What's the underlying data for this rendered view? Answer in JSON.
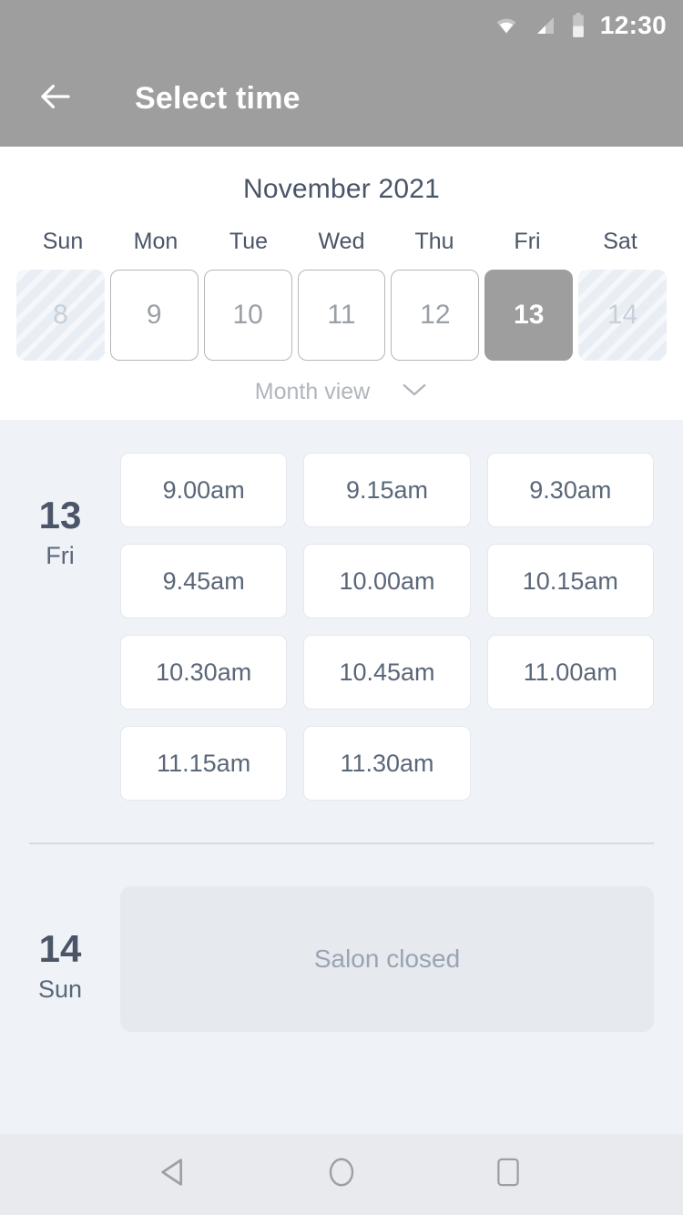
{
  "status_bar": {
    "time": "12:30",
    "icons": [
      "wifi-icon",
      "cellular-signal-icon",
      "battery-icon"
    ]
  },
  "app_bar": {
    "back_icon": "arrow-left-icon",
    "title": "Select time"
  },
  "calendar": {
    "title": "November 2021",
    "weekdays": [
      "Sun",
      "Mon",
      "Tue",
      "Wed",
      "Thu",
      "Fri",
      "Sat"
    ],
    "days": [
      {
        "label": "8",
        "state": "disabled"
      },
      {
        "label": "9",
        "state": "available"
      },
      {
        "label": "10",
        "state": "available"
      },
      {
        "label": "11",
        "state": "available"
      },
      {
        "label": "12",
        "state": "available"
      },
      {
        "label": "13",
        "state": "selected"
      },
      {
        "label": "14",
        "state": "disabled"
      }
    ],
    "month_view": {
      "label": "Month view",
      "chevron_icon": "chevron-down-icon"
    }
  },
  "schedule": {
    "groups": [
      {
        "day_number": "13",
        "day_name": "Fri",
        "slots": [
          "9.00am",
          "9.15am",
          "9.30am",
          "9.45am",
          "10.00am",
          "10.15am",
          "10.30am",
          "10.45am",
          "11.00am",
          "11.15am",
          "11.30am"
        ]
      },
      {
        "day_number": "14",
        "day_name": "Sun",
        "closed_message": "Salon closed"
      }
    ]
  },
  "nav_bar": {
    "back_icon": "nav-back-triangle-icon",
    "home_icon": "nav-home-circle-icon",
    "recents_icon": "nav-recents-square-icon"
  },
  "colors": {
    "app_bar": "#9e9e9e",
    "body_background": "#eff2f7",
    "panel": "#ffffff",
    "text_primary": "#4a5568",
    "text_secondary": "#5a6779",
    "text_muted": "#9aa4b2",
    "selected_day": "#9e9e9e",
    "nav_bar": "#e8eaed"
  }
}
